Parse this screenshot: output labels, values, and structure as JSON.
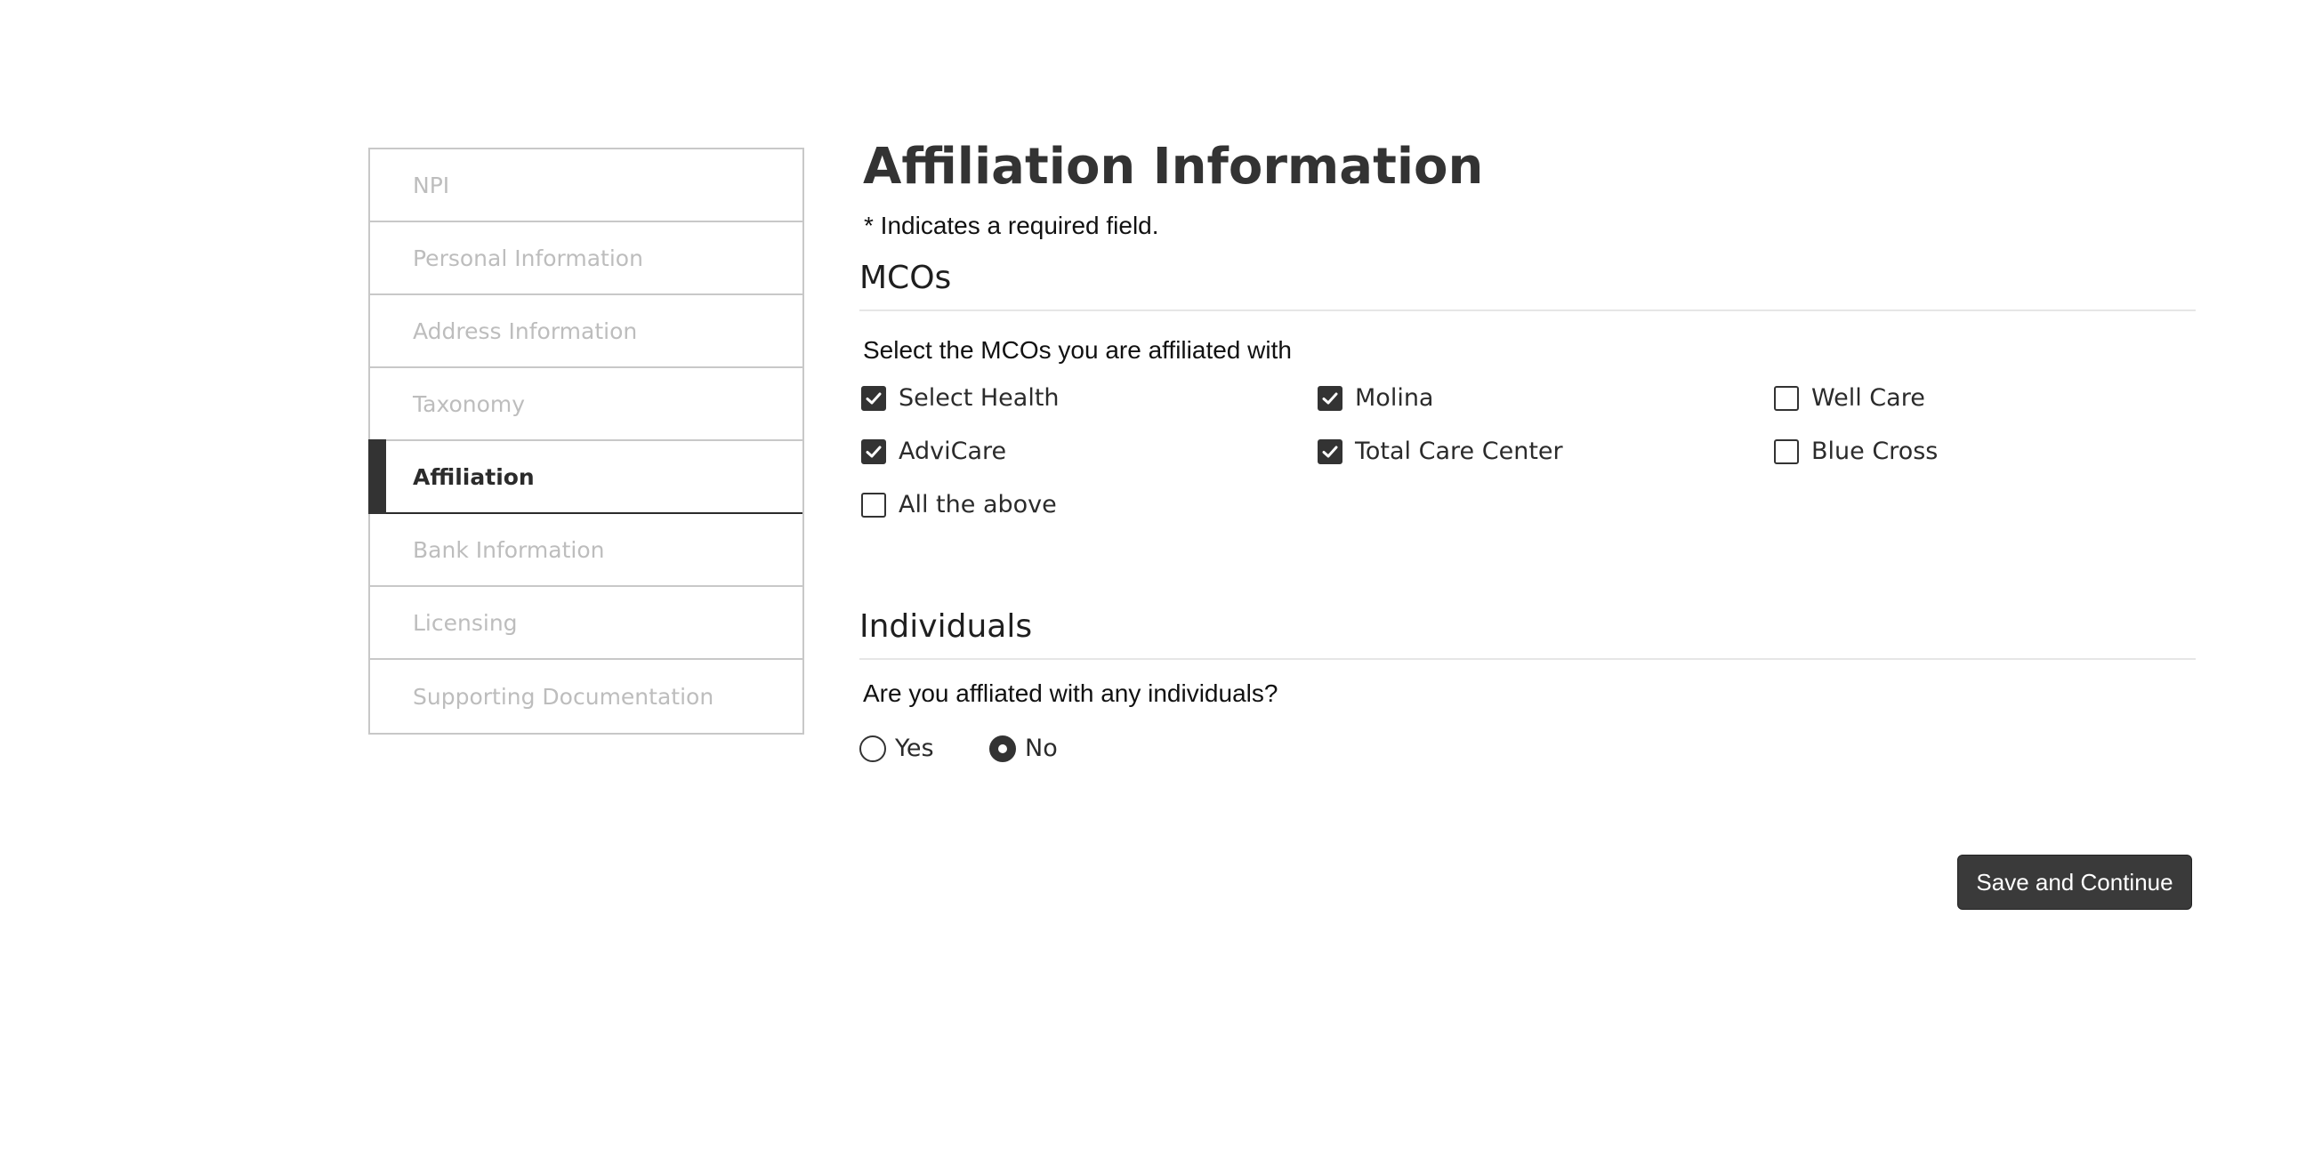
{
  "sidebar": {
    "items": [
      {
        "label": "NPI",
        "active": false
      },
      {
        "label": "Personal Information",
        "active": false
      },
      {
        "label": "Address Information",
        "active": false
      },
      {
        "label": "Taxonomy",
        "active": false
      },
      {
        "label": "Affiliation",
        "active": true
      },
      {
        "label": "Bank Information",
        "active": false
      },
      {
        "label": "Licensing",
        "active": false
      },
      {
        "label": "Supporting Documentation",
        "active": false
      }
    ]
  },
  "main": {
    "title": "Affiliation Information",
    "required_note": "* Indicates a required field.",
    "mcos": {
      "heading": "MCOs",
      "prompt": "Select the MCOs you are affiliated with",
      "options": [
        {
          "label": "Select Health",
          "checked": true
        },
        {
          "label": "Molina",
          "checked": true
        },
        {
          "label": "Well Care",
          "checked": false
        },
        {
          "label": "AdviCare",
          "checked": true
        },
        {
          "label": "Total Care Center",
          "checked": true
        },
        {
          "label": "Blue Cross",
          "checked": false
        },
        {
          "label": "All the above",
          "checked": false
        }
      ]
    },
    "individuals": {
      "heading": "Individuals",
      "prompt": "Are you affliated with any individuals?",
      "options": [
        {
          "label": "Yes",
          "selected": false
        },
        {
          "label": "No",
          "selected": true
        }
      ]
    },
    "save_label": "Save and Continue"
  },
  "colors": {
    "accent": "#333333",
    "muted_text": "#bdbdbd",
    "border": "#c8c8c8"
  }
}
